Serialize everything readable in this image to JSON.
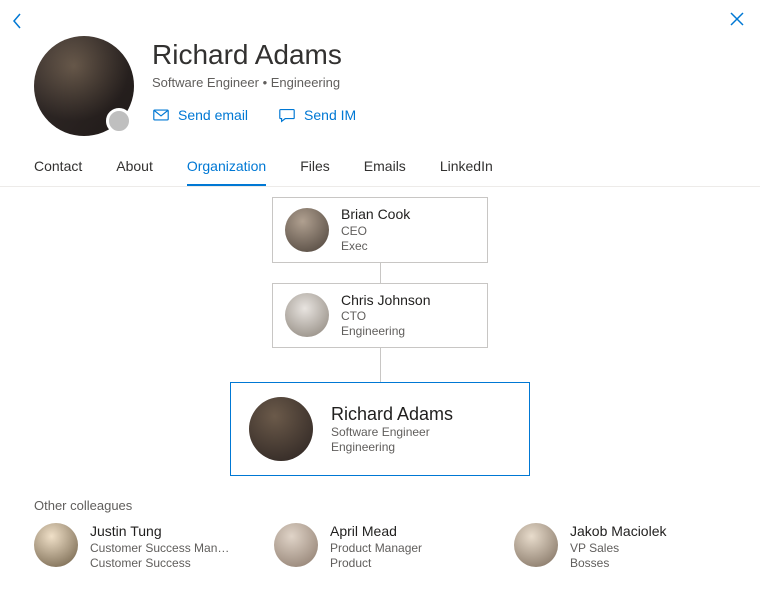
{
  "header": {
    "name": "Richard Adams",
    "subtitle": "Software Engineer  •  Engineering",
    "actions": {
      "send_email": "Send email",
      "send_im": "Send IM"
    }
  },
  "tabs": [
    {
      "label": "Contact"
    },
    {
      "label": "About"
    },
    {
      "label": "Organization"
    },
    {
      "label": "Files"
    },
    {
      "label": "Emails"
    },
    {
      "label": "LinkedIn"
    }
  ],
  "active_tab_index": 2,
  "org_chain": [
    {
      "name": "Brian Cook",
      "role": "CEO",
      "dept": "Exec"
    },
    {
      "name": "Chris Johnson",
      "role": "CTO",
      "dept": "Engineering"
    },
    {
      "name": "Richard Adams",
      "role": "Software Engineer",
      "dept": "Engineering"
    }
  ],
  "colleagues_heading": "Other colleagues",
  "colleagues": [
    {
      "name": "Justin Tung",
      "role": "Customer Success Man…",
      "dept": "Customer Success"
    },
    {
      "name": "April Mead",
      "role": "Product Manager",
      "dept": "Product"
    },
    {
      "name": "Jakob Maciolek",
      "role": "VP Sales",
      "dept": "Bosses"
    }
  ],
  "colors": {
    "accent": "#0078d4"
  }
}
